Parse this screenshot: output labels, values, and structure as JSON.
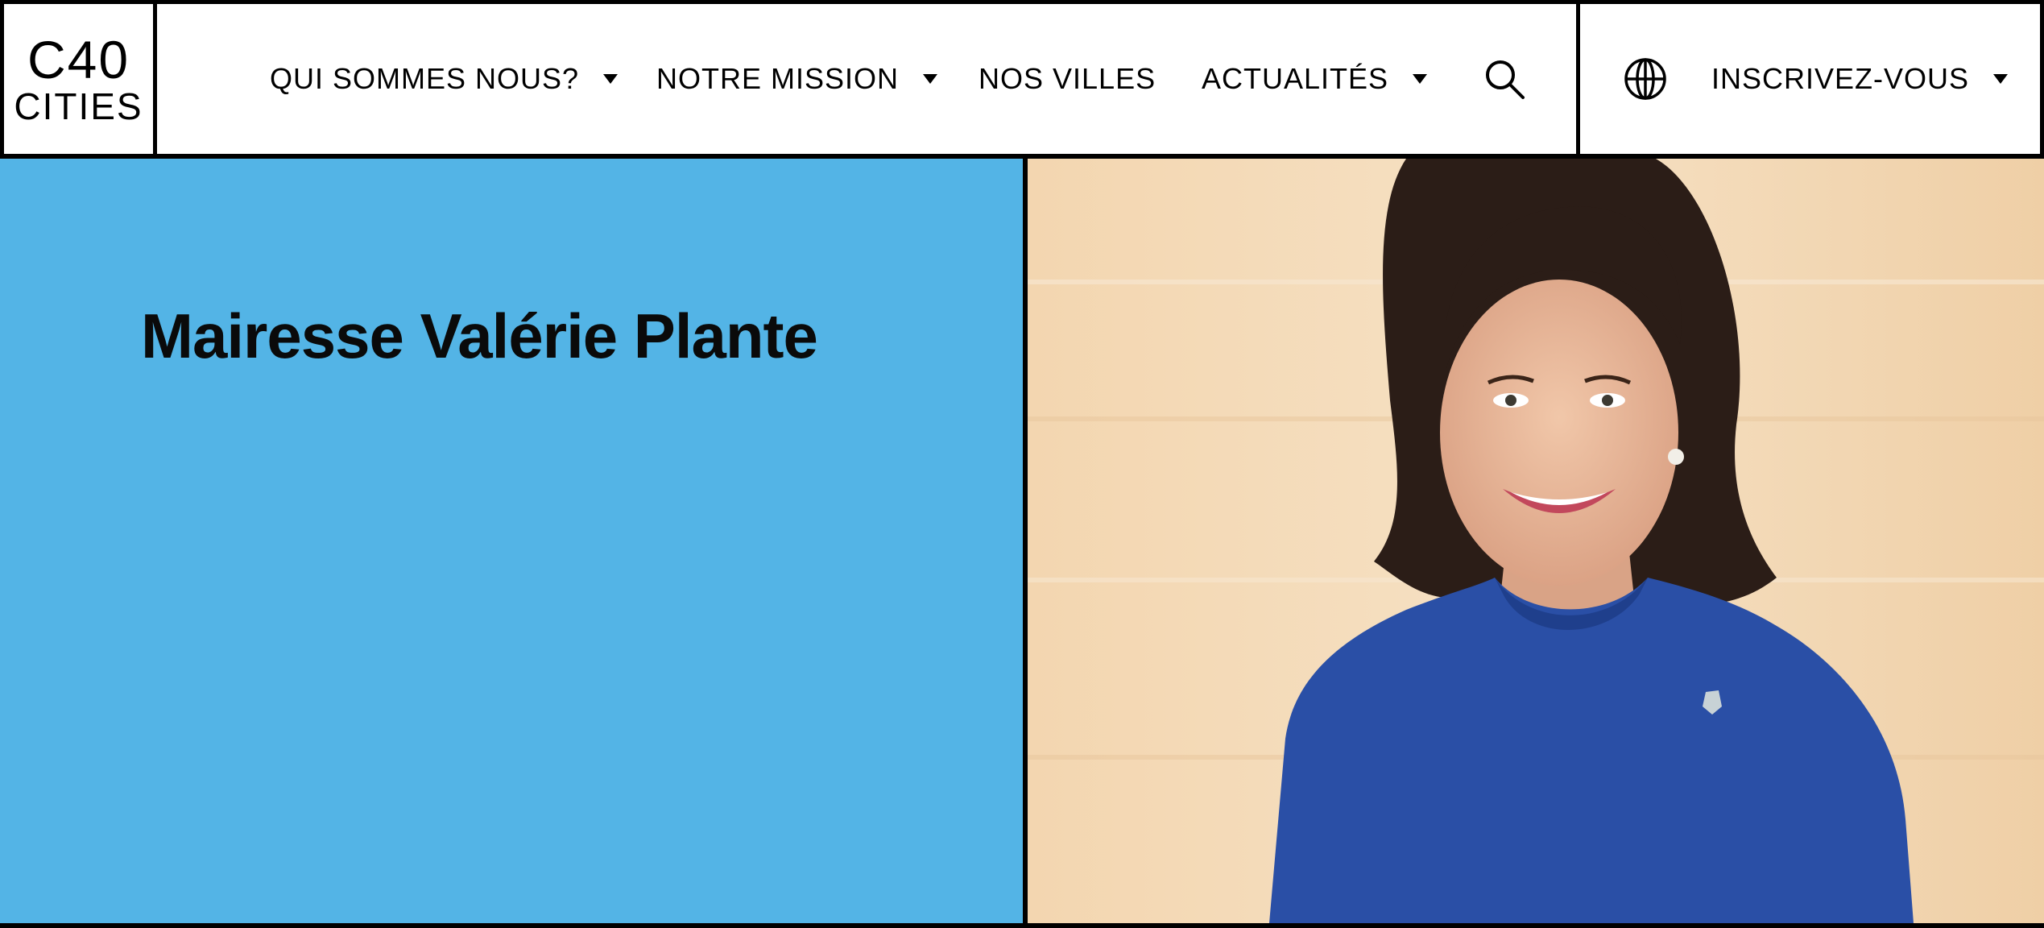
{
  "logo": {
    "line1": "C40",
    "line2": "CITIES"
  },
  "nav": {
    "items": [
      {
        "label": "QUI SOMMES NOUS?",
        "has_dropdown": true
      },
      {
        "label": "NOTRE MISSION",
        "has_dropdown": true
      },
      {
        "label": "NOS VILLES",
        "has_dropdown": false
      },
      {
        "label": "ACTUALITÉS",
        "has_dropdown": true
      }
    ],
    "search_icon": "search-icon",
    "language_icon": "globe-icon",
    "signup": {
      "label": "INSCRIVEZ-VOUS",
      "has_dropdown": true
    }
  },
  "hero": {
    "title": "Mairesse Valérie Plante",
    "panel_color": "#53b4e6",
    "photo_subject": "portrait photo"
  },
  "colors": {
    "accent_blue": "#53b4e6",
    "border": "#000000"
  }
}
